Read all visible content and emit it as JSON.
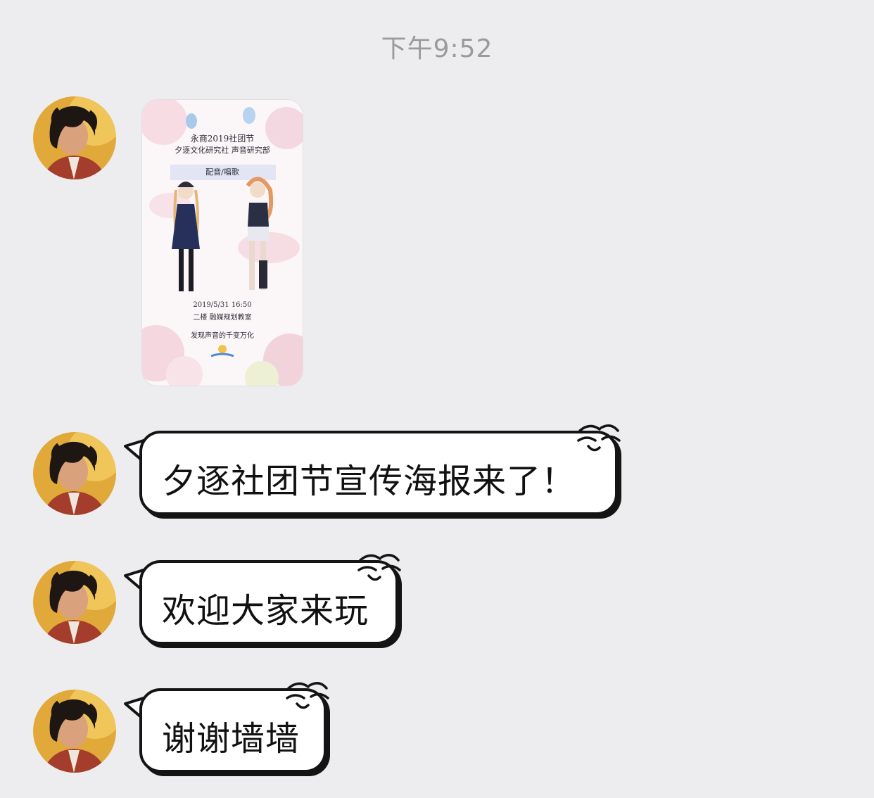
{
  "chat": {
    "timestamp": "下午9:52",
    "messages": [
      {
        "type": "image",
        "poster": {
          "title": "永商2019社团节",
          "clubs": "夕逐文化研究社   声音研究部",
          "subtitle": "配音/唱歌",
          "datetime": "2019/5/31   16:50",
          "location": "二楼   融媒规划教室",
          "slogan": "发现声音的千变万化"
        }
      },
      {
        "type": "text",
        "text": "夕逐社团节宣传海报来了！"
      },
      {
        "type": "text",
        "text": "欢迎大家来玩"
      },
      {
        "type": "text",
        "text": "谢谢墙墙"
      }
    ]
  },
  "colors": {
    "background": "#ededf0",
    "bubble_fill": "#ffffff",
    "bubble_outline": "#141414",
    "timestamp": "#9a9a9a"
  },
  "icons": {
    "avatar": "user-avatar",
    "bubble_decoration": "sweat-drop-doodle-icon"
  }
}
